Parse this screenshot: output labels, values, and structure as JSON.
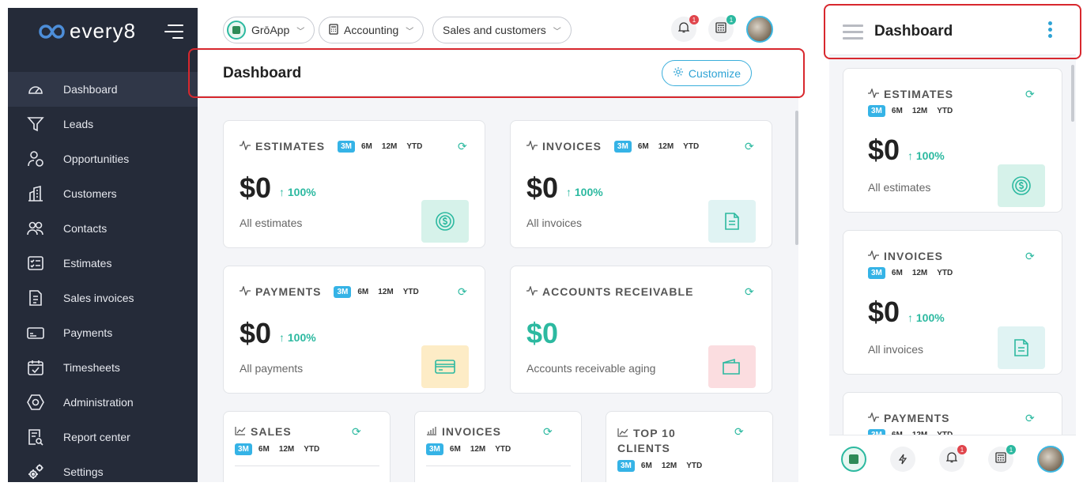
{
  "brand": {
    "name": "every8"
  },
  "sidebar": {
    "items": [
      {
        "label": "Dashboard",
        "icon": "speedometer-icon",
        "active": true
      },
      {
        "label": "Leads",
        "icon": "funnel-icon"
      },
      {
        "label": "Opportunities",
        "icon": "user-dollar-icon"
      },
      {
        "label": "Customers",
        "icon": "buildings-icon"
      },
      {
        "label": "Contacts",
        "icon": "people-icon"
      },
      {
        "label": "Estimates",
        "icon": "checklist-icon"
      },
      {
        "label": "Sales invoices",
        "icon": "invoice-icon"
      },
      {
        "label": "Payments",
        "icon": "bill-icon"
      },
      {
        "label": "Timesheets",
        "icon": "calendar-check-icon"
      },
      {
        "label": "Administration",
        "icon": "hexagon-gear-icon"
      },
      {
        "label": "Report center",
        "icon": "report-search-icon"
      },
      {
        "label": "Settings",
        "icon": "gears-icon"
      }
    ]
  },
  "topbar": {
    "company": "GrōApp",
    "module": "Accounting",
    "section": "Sales and customers",
    "notifications_count": "1",
    "calculator_count": "1"
  },
  "page": {
    "title": "Dashboard",
    "customize_label": "Customize"
  },
  "periods": [
    "3M",
    "6M",
    "12M",
    "YTD"
  ],
  "cards": {
    "estimates": {
      "title": "ESTIMATES",
      "amount": "$0",
      "trend": "↑ 100%",
      "sub": "All estimates"
    },
    "invoices": {
      "title": "INVOICES",
      "amount": "$0",
      "trend": "↑ 100%",
      "sub": "All invoices"
    },
    "payments": {
      "title": "PAYMENTS",
      "amount": "$0",
      "trend": "↑ 100%",
      "sub": "All payments"
    },
    "receivable": {
      "title": "ACCOUNTS RECEIVABLE",
      "amount": "$0",
      "sub": "Accounts receivable aging"
    }
  },
  "bottom_cards": {
    "sales": {
      "title": "SALES"
    },
    "invoices": {
      "title": "INVOICES"
    },
    "top_clients": {
      "title_line1": "TOP 10",
      "title_line2": "CLIENTS"
    }
  },
  "mobile": {
    "title": "Dashboard"
  },
  "colors": {
    "accent": "#35b3e6",
    "green": "#2cb9a0",
    "sidebar": "#252b39",
    "highlight": "#d8282e"
  }
}
